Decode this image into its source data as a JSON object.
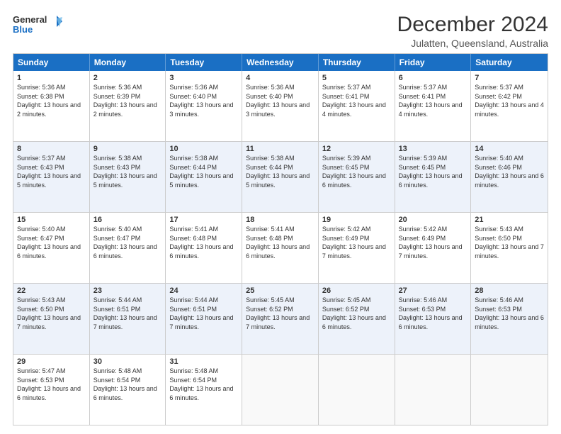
{
  "logo": {
    "line1": "General",
    "line2": "Blue"
  },
  "title": "December 2024",
  "subtitle": "Julatten, Queensland, Australia",
  "days_of_week": [
    "Sunday",
    "Monday",
    "Tuesday",
    "Wednesday",
    "Thursday",
    "Friday",
    "Saturday"
  ],
  "weeks": [
    [
      {
        "day": "1",
        "sunrise": "5:36 AM",
        "sunset": "6:38 PM",
        "daylight": "13 hours and 2 minutes."
      },
      {
        "day": "2",
        "sunrise": "5:36 AM",
        "sunset": "6:39 PM",
        "daylight": "13 hours and 2 minutes."
      },
      {
        "day": "3",
        "sunrise": "5:36 AM",
        "sunset": "6:40 PM",
        "daylight": "13 hours and 3 minutes."
      },
      {
        "day": "4",
        "sunrise": "5:36 AM",
        "sunset": "6:40 PM",
        "daylight": "13 hours and 3 minutes."
      },
      {
        "day": "5",
        "sunrise": "5:37 AM",
        "sunset": "6:41 PM",
        "daylight": "13 hours and 4 minutes."
      },
      {
        "day": "6",
        "sunrise": "5:37 AM",
        "sunset": "6:41 PM",
        "daylight": "13 hours and 4 minutes."
      },
      {
        "day": "7",
        "sunrise": "5:37 AM",
        "sunset": "6:42 PM",
        "daylight": "13 hours and 4 minutes."
      }
    ],
    [
      {
        "day": "8",
        "sunrise": "5:37 AM",
        "sunset": "6:43 PM",
        "daylight": "13 hours and 5 minutes."
      },
      {
        "day": "9",
        "sunrise": "5:38 AM",
        "sunset": "6:43 PM",
        "daylight": "13 hours and 5 minutes."
      },
      {
        "day": "10",
        "sunrise": "5:38 AM",
        "sunset": "6:44 PM",
        "daylight": "13 hours and 5 minutes."
      },
      {
        "day": "11",
        "sunrise": "5:38 AM",
        "sunset": "6:44 PM",
        "daylight": "13 hours and 5 minutes."
      },
      {
        "day": "12",
        "sunrise": "5:39 AM",
        "sunset": "6:45 PM",
        "daylight": "13 hours and 6 minutes."
      },
      {
        "day": "13",
        "sunrise": "5:39 AM",
        "sunset": "6:45 PM",
        "daylight": "13 hours and 6 minutes."
      },
      {
        "day": "14",
        "sunrise": "5:40 AM",
        "sunset": "6:46 PM",
        "daylight": "13 hours and 6 minutes."
      }
    ],
    [
      {
        "day": "15",
        "sunrise": "5:40 AM",
        "sunset": "6:47 PM",
        "daylight": "13 hours and 6 minutes."
      },
      {
        "day": "16",
        "sunrise": "5:40 AM",
        "sunset": "6:47 PM",
        "daylight": "13 hours and 6 minutes."
      },
      {
        "day": "17",
        "sunrise": "5:41 AM",
        "sunset": "6:48 PM",
        "daylight": "13 hours and 6 minutes."
      },
      {
        "day": "18",
        "sunrise": "5:41 AM",
        "sunset": "6:48 PM",
        "daylight": "13 hours and 6 minutes."
      },
      {
        "day": "19",
        "sunrise": "5:42 AM",
        "sunset": "6:49 PM",
        "daylight": "13 hours and 7 minutes."
      },
      {
        "day": "20",
        "sunrise": "5:42 AM",
        "sunset": "6:49 PM",
        "daylight": "13 hours and 7 minutes."
      },
      {
        "day": "21",
        "sunrise": "5:43 AM",
        "sunset": "6:50 PM",
        "daylight": "13 hours and 7 minutes."
      }
    ],
    [
      {
        "day": "22",
        "sunrise": "5:43 AM",
        "sunset": "6:50 PM",
        "daylight": "13 hours and 7 minutes."
      },
      {
        "day": "23",
        "sunrise": "5:44 AM",
        "sunset": "6:51 PM",
        "daylight": "13 hours and 7 minutes."
      },
      {
        "day": "24",
        "sunrise": "5:44 AM",
        "sunset": "6:51 PM",
        "daylight": "13 hours and 7 minutes."
      },
      {
        "day": "25",
        "sunrise": "5:45 AM",
        "sunset": "6:52 PM",
        "daylight": "13 hours and 7 minutes."
      },
      {
        "day": "26",
        "sunrise": "5:45 AM",
        "sunset": "6:52 PM",
        "daylight": "13 hours and 6 minutes."
      },
      {
        "day": "27",
        "sunrise": "5:46 AM",
        "sunset": "6:53 PM",
        "daylight": "13 hours and 6 minutes."
      },
      {
        "day": "28",
        "sunrise": "5:46 AM",
        "sunset": "6:53 PM",
        "daylight": "13 hours and 6 minutes."
      }
    ],
    [
      {
        "day": "29",
        "sunrise": "5:47 AM",
        "sunset": "6:53 PM",
        "daylight": "13 hours and 6 minutes."
      },
      {
        "day": "30",
        "sunrise": "5:48 AM",
        "sunset": "6:54 PM",
        "daylight": "13 hours and 6 minutes."
      },
      {
        "day": "31",
        "sunrise": "5:48 AM",
        "sunset": "6:54 PM",
        "daylight": "13 hours and 6 minutes."
      },
      null,
      null,
      null,
      null
    ]
  ],
  "labels": {
    "sunrise": "Sunrise:",
    "sunset": "Sunset:",
    "daylight": "Daylight:"
  }
}
